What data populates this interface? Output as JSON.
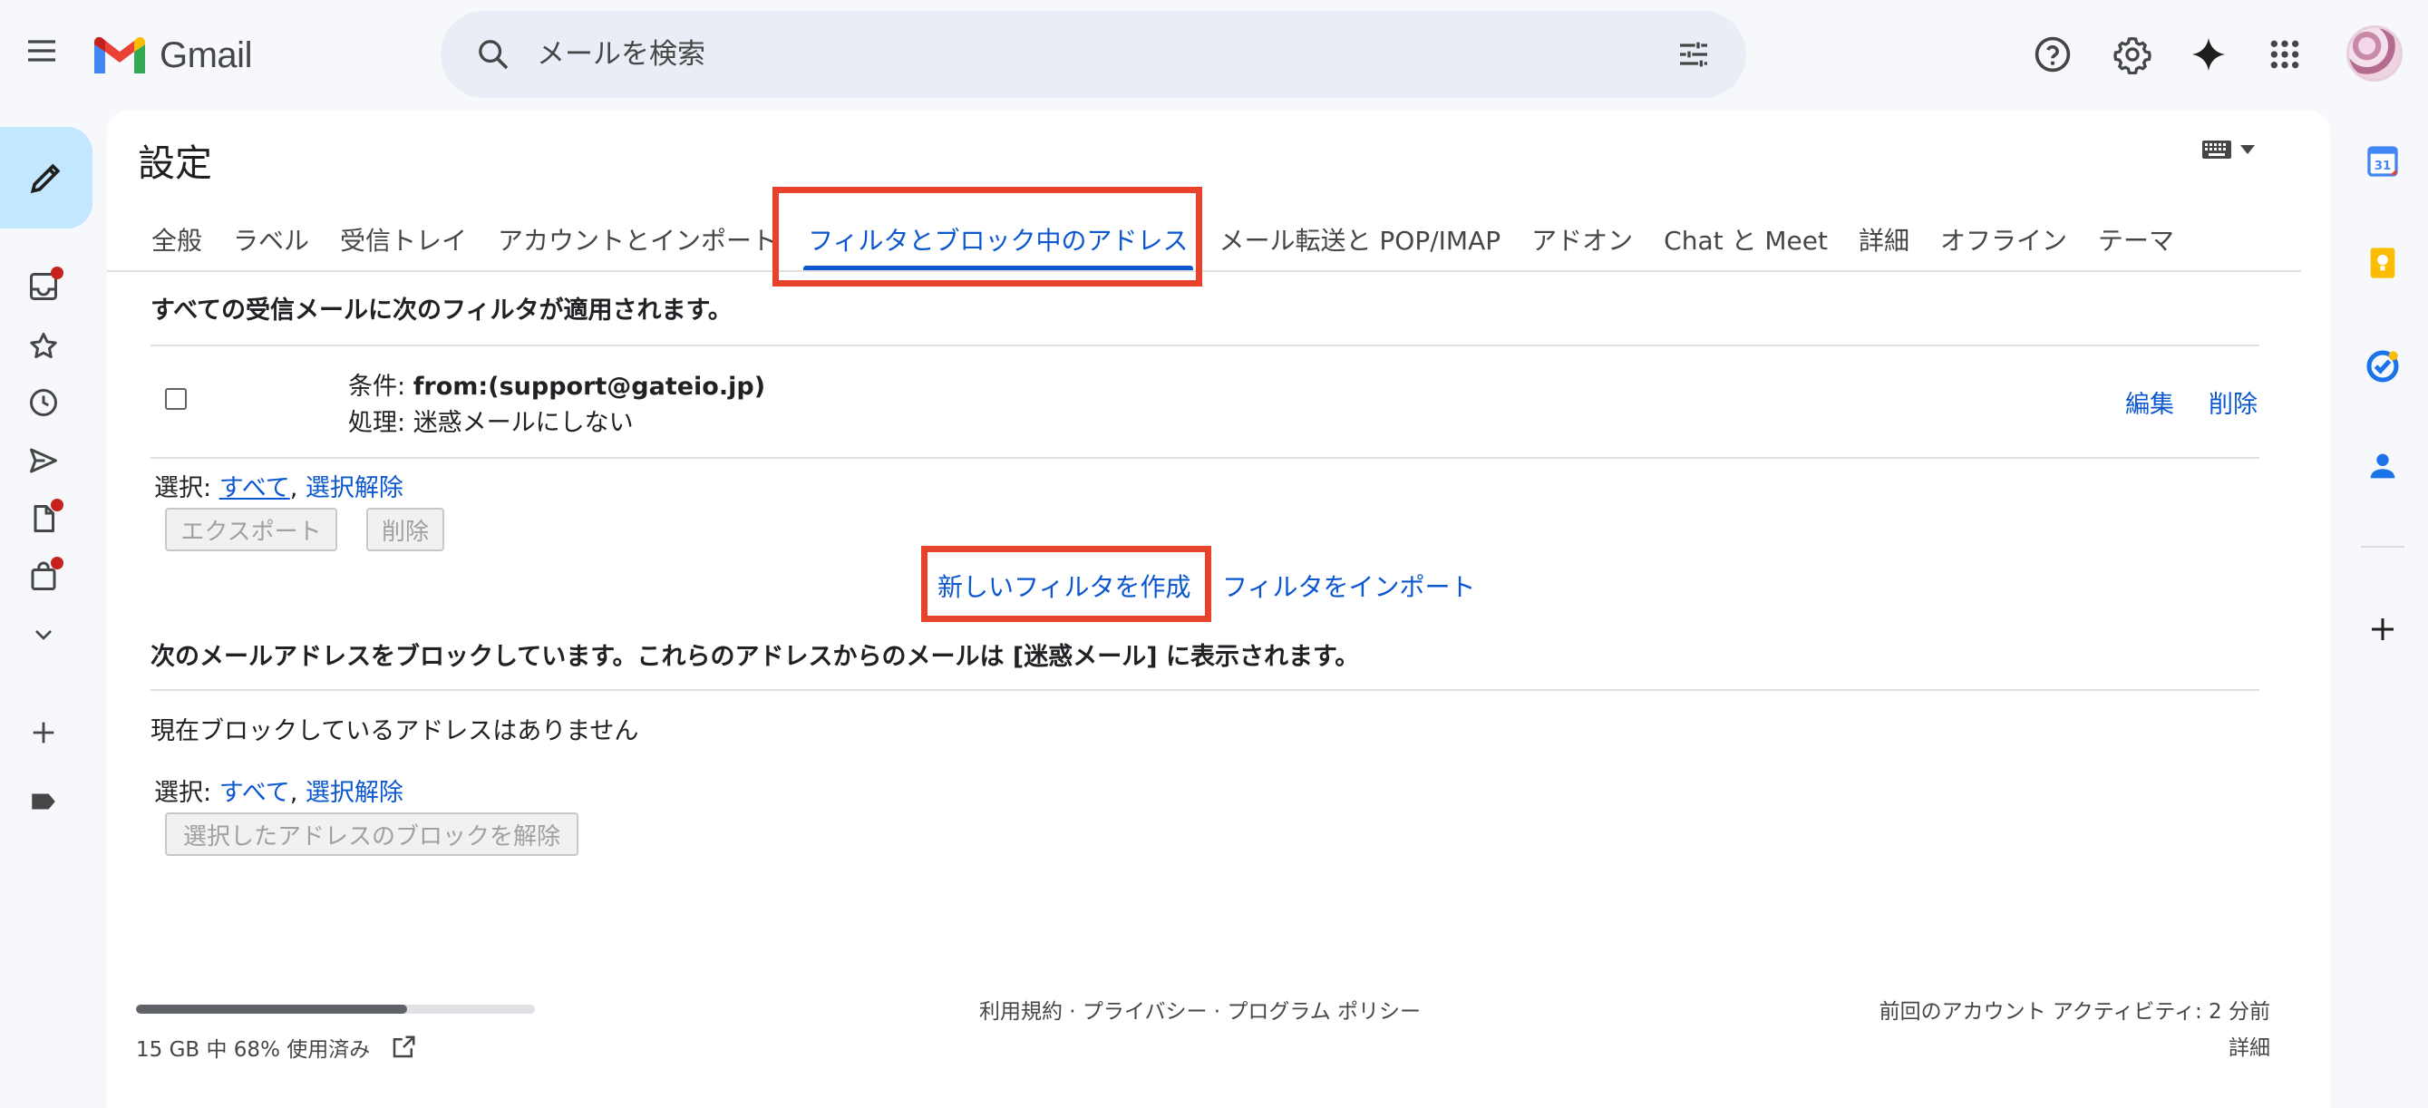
{
  "app": {
    "brand": "Gmail"
  },
  "search": {
    "placeholder": "メールを検索"
  },
  "settings": {
    "title": "設定",
    "tabs": [
      {
        "label": "全般"
      },
      {
        "label": "ラベル"
      },
      {
        "label": "受信トレイ"
      },
      {
        "label": "アカウントとインポート"
      },
      {
        "label": "フィルタとブロック中のアドレス",
        "active": true
      },
      {
        "label": "メール転送と POP/IMAP"
      },
      {
        "label": "アドオン"
      },
      {
        "label": "Chat と Meet"
      },
      {
        "label": "詳細"
      },
      {
        "label": "オフライン"
      },
      {
        "label": "テーマ"
      }
    ]
  },
  "filters": {
    "heading": "すべての受信メールに次のフィルタが適用されます。",
    "rows": [
      {
        "criteria_label": "条件: ",
        "criteria_value": "from:(support@gateio.jp)",
        "action_label": "処理: ",
        "action_value": "迷惑メールにしない",
        "edit": "編集",
        "delete": "削除"
      }
    ],
    "select_label": "選択: ",
    "select_all": "すべて",
    "select_separator": ", ",
    "select_none": "選択解除",
    "export_button": "エクスポート",
    "delete_button": "削除",
    "create_new": "新しいフィルタを作成",
    "import": "フィルタをインポート"
  },
  "blocked": {
    "heading": "次のメールアドレスをブロックしています。これらのアドレスからのメールは [迷惑メール] に表示されます。",
    "empty_message": "現在ブロックしているアドレスはありません",
    "select_label": "選択: ",
    "select_all": "すべて",
    "select_separator": ", ",
    "select_none": "選択解除",
    "unblock_button": "選択したアドレスのブロックを解除"
  },
  "footer": {
    "storage_text": "15 GB 中 68% 使用済み",
    "storage_fraction": 0.68,
    "policy_links": "利用規約 · プライバシー · プログラム ポリシー",
    "last_activity": "前回のアカウント アクティビティ: 2 分前",
    "details": "詳細"
  },
  "icons": {
    "menu": "menu-icon",
    "search": "search-icon",
    "search_options": "tune-icon",
    "help": "help-icon",
    "settings": "gear-icon",
    "gemini": "sparkle-icon",
    "apps": "apps-grid-icon",
    "compose": "pencil-icon",
    "inbox": "inbox-icon",
    "starred": "star-icon",
    "snoozed": "clock-icon",
    "sent": "send-icon",
    "drafts": "draft-icon",
    "purchases": "shopping-bag-icon",
    "more": "chevron-down-icon",
    "add_label": "plus-icon",
    "label": "label-icon",
    "calendar": "calendar-icon",
    "keep": "keep-icon",
    "tasks": "tasks-icon",
    "contacts": "contacts-icon",
    "add_addon": "plus-icon",
    "keyboard": "keyboard-icon"
  },
  "colors": {
    "accent": "#0b57d0",
    "highlight": "#e8412c",
    "notification_dot": "#c5221f"
  }
}
